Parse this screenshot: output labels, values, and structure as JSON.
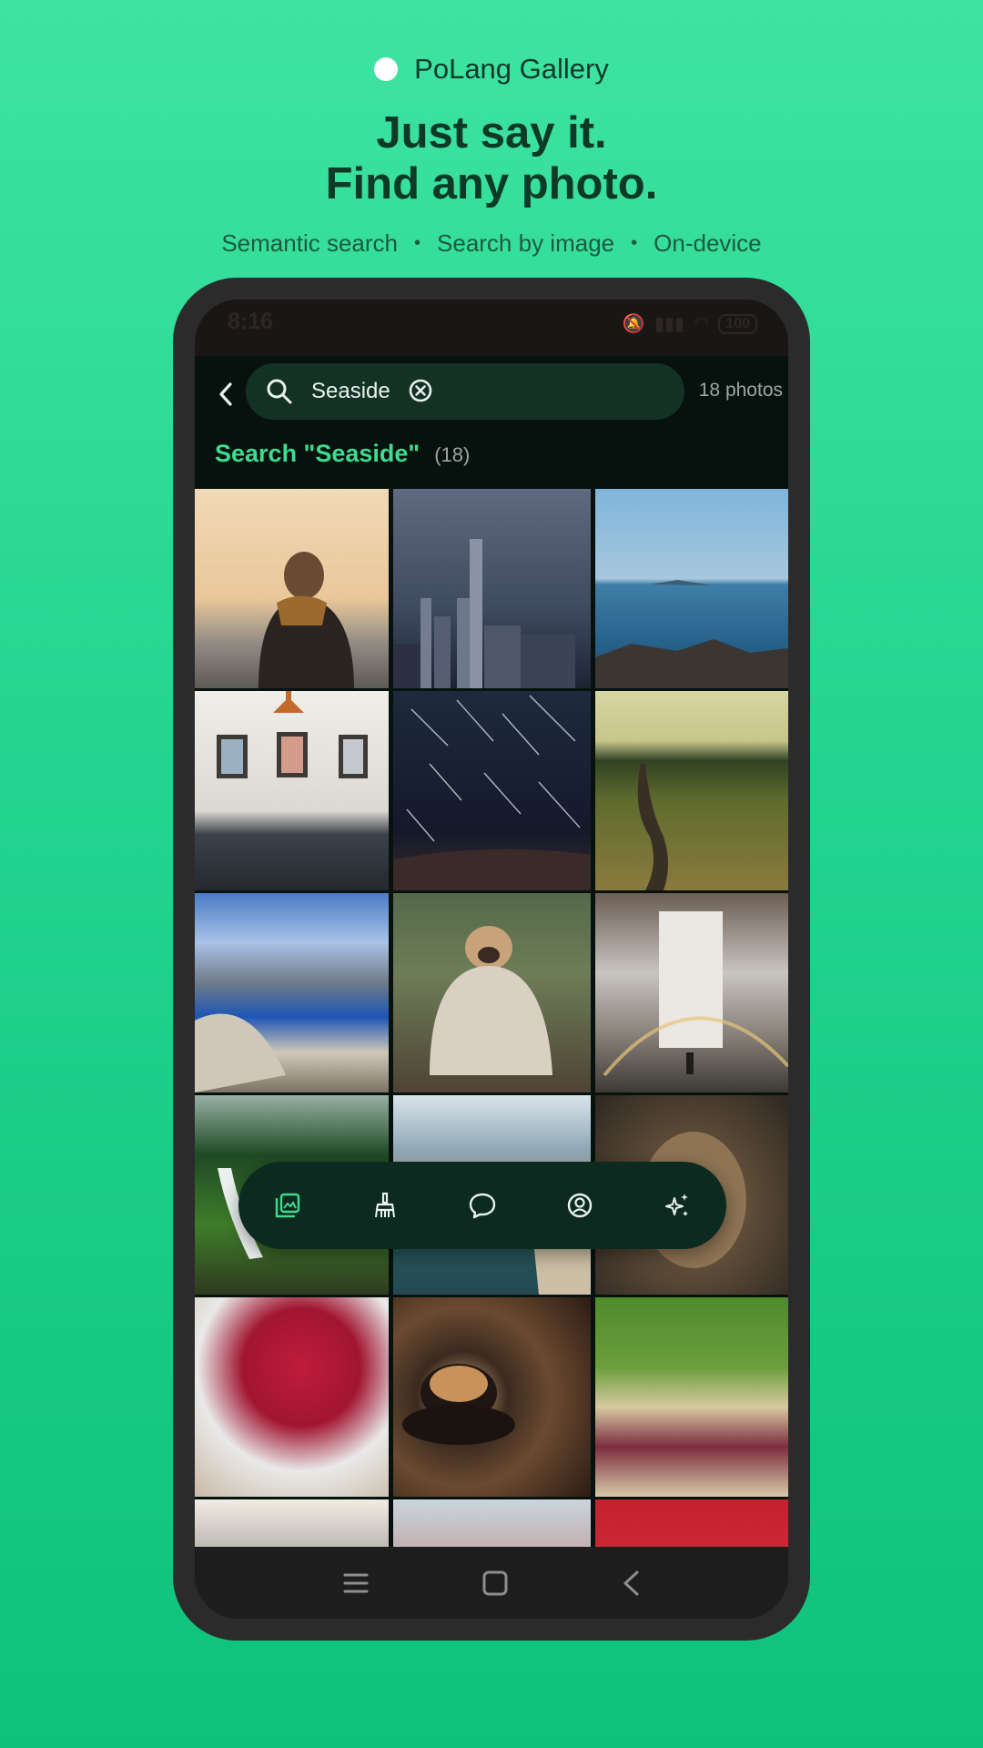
{
  "brand": {
    "name": "PoLang Gallery"
  },
  "headline": {
    "line1": "Just say it.",
    "line2": "Find any photo."
  },
  "features": [
    "Semantic search",
    "Search by image",
    "On-device"
  ],
  "status_bar": {
    "time": "8:16",
    "battery": "100"
  },
  "search": {
    "query": "Seaside",
    "photo_count": "18 photos"
  },
  "results": {
    "title": "Search \"Seaside\"",
    "count": "(18)"
  },
  "photos": [
    "man-in-jacket-at-beach",
    "city-skyline-dusk",
    "rocky-coast-sea",
    "restaurant-interior",
    "star-trails-night",
    "grass-field-path",
    "fjord-cliff-view",
    "pug-in-blanket",
    "waterfall-rainbow",
    "forest-waterfall",
    "sea-cliffs-aerial",
    "lioness-portrait",
    "raspberries-bowl",
    "coffee-cup-table",
    "vegetables-onion",
    "dark-photo",
    "red-item-photo",
    "strawberries"
  ],
  "bottom_nav": [
    "gallery-icon",
    "clean-icon",
    "chat-icon",
    "profile-icon",
    "sparkle-icon"
  ],
  "colors": {
    "accent": "#3ddc8f",
    "background": "#22d48f",
    "app_bg": "#07120e"
  }
}
